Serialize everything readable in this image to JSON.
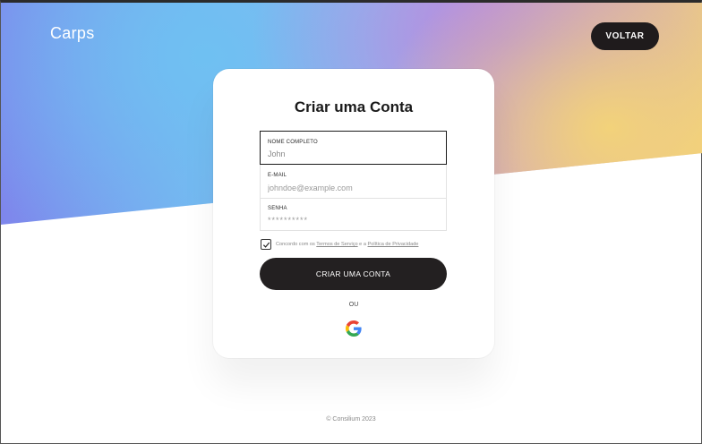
{
  "header": {
    "brand": "Carps",
    "back_label": "VOLTAR"
  },
  "signup": {
    "title": "Criar uma Conta",
    "fields": [
      {
        "label": "NOME COMPLETO",
        "value": "John",
        "placeholder": ""
      },
      {
        "label": "E-MAIL",
        "value": "",
        "placeholder": "johndoe@example.com"
      },
      {
        "label": "SENHA",
        "value": "",
        "placeholder": "**********"
      }
    ],
    "terms": {
      "checked": true,
      "prefix": "Concordo com os ",
      "terms_link": "Termos de Serviço",
      "middle": " e a ",
      "privacy_link": "Política de Privacidade"
    },
    "submit_label": "CRIAR UMA CONTA",
    "or_label": "OU",
    "google_icon": "google-logo-icon"
  },
  "footer": {
    "text": "© Consilium 2023"
  },
  "colors": {
    "dark_button": "#232021",
    "card_bg": "#ffffff",
    "gradient": [
      "#7e86ec",
      "#76b6f0",
      "#b48be0",
      "#f1cf7e"
    ]
  }
}
